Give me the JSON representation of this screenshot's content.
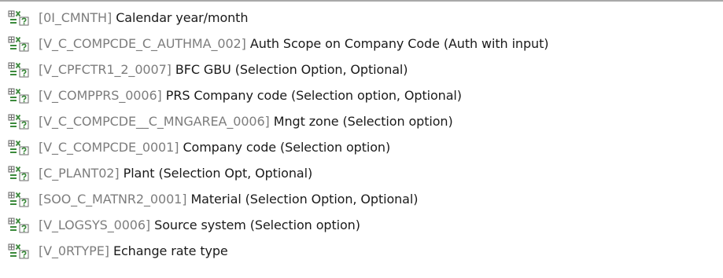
{
  "variables": {
    "icon": "variable-icon",
    "items": [
      {
        "tech": "[0I_CMNTH]",
        "desc": "Calendar year/month"
      },
      {
        "tech": "[V_C_COMPCDE_C_AUTHMA_002]",
        "desc": "Auth Scope on Company Code (Auth with input)"
      },
      {
        "tech": "[V_CPFCTR1_2_0007]",
        "desc": "BFC GBU (Selection Option, Optional)"
      },
      {
        "tech": "[V_COMPPRS_0006]",
        "desc": "PRS Company code (Selection option, Optional)"
      },
      {
        "tech": "[V_C_COMPCDE__C_MNGAREA_0006]",
        "desc": "Mngt zone (Selection option)"
      },
      {
        "tech": "[V_C_COMPCDE_0001]",
        "desc": "Company code (Selection option)"
      },
      {
        "tech": "[C_PLANT02]",
        "desc": "Plant (Selection Opt, Optional)"
      },
      {
        "tech": "[SOO_C_MATNR2_0001]",
        "desc": "Material (Selection Option, Optional)"
      },
      {
        "tech": "[V_LOGSYS_0006]",
        "desc": "Source system (Selection option)"
      },
      {
        "tech": "[V_0RTYPE]",
        "desc": "Echange rate type"
      }
    ]
  },
  "colors": {
    "icon_green": "#3c8a3c",
    "icon_gray": "#6a6a6a",
    "tech_text": "#7d7d7d",
    "desc_text": "#1a1a1a"
  }
}
